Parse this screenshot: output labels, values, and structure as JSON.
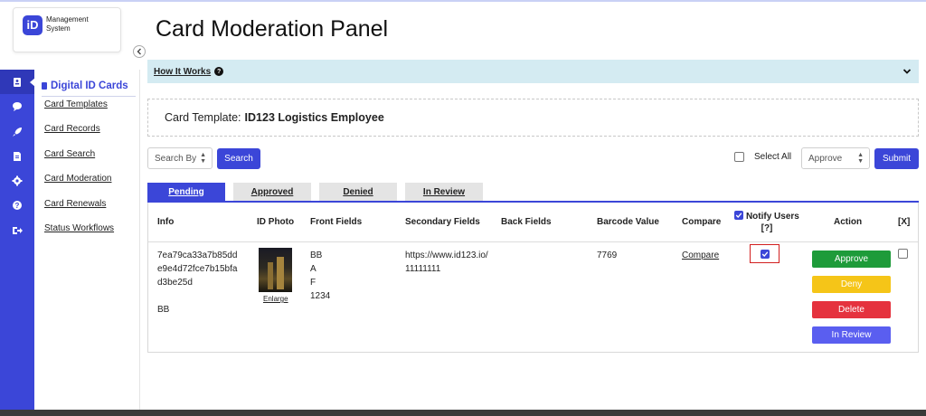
{
  "brand": {
    "logo_letters": "iD",
    "line1": "Management",
    "line2": "System"
  },
  "rail": {
    "icons": [
      "id-card-icon",
      "chat-icon",
      "rocket-icon",
      "document-icon",
      "gear-icon",
      "help-icon",
      "logout-icon"
    ]
  },
  "sidebar": {
    "heading": "Digital ID Cards",
    "items": [
      {
        "label": "Card Templates"
      },
      {
        "label": "Card Records"
      },
      {
        "label": "Card Search"
      },
      {
        "label": "Card Moderation"
      },
      {
        "label": "Card Renewals"
      },
      {
        "label": "Status Workflows"
      }
    ]
  },
  "page": {
    "title": "Card Moderation Panel"
  },
  "how_it_works": {
    "label": "How It Works"
  },
  "template": {
    "label": "Card Template:",
    "value": "ID123 Logistics Employee"
  },
  "toolbar": {
    "search_by": "Search By",
    "search_button": "Search",
    "select_all": "Select All",
    "action_select": "Approve",
    "submit_button": "Submit"
  },
  "tabs": [
    {
      "label": "Pending",
      "active": true
    },
    {
      "label": "Approved",
      "active": false
    },
    {
      "label": "Denied",
      "active": false
    },
    {
      "label": "In Review",
      "active": false
    }
  ],
  "table": {
    "headers": {
      "info": "Info",
      "id_photo": "ID Photo",
      "front_fields": "Front Fields",
      "secondary_fields": "Secondary Fields",
      "back_fields": "Back Fields",
      "barcode_value": "Barcode Value",
      "compare": "Compare",
      "notify_users": "Notify Users",
      "notify_help": "[?]",
      "action": "Action",
      "x": "[X]"
    },
    "rows": [
      {
        "info_line1": "7ea79ca33a7b85dd",
        "info_line2": "e9e4d72fce7b15bfa",
        "info_line3": "d3be25d",
        "info_name": "BB",
        "photo_link": "Enlarge",
        "front_1": "BB",
        "front_2": "A",
        "front_3": "F",
        "front_4": "1234",
        "secondary_1": "https://www.id123.io/",
        "secondary_2": "11111111",
        "barcode": "7769",
        "compare": "Compare",
        "notify_checked": true,
        "actions": {
          "approve": "Approve",
          "deny": "Deny",
          "delete": "Delete",
          "in_review": "In Review"
        }
      }
    ]
  },
  "colors": {
    "primary": "#3b46d8",
    "info_banner": "#d4ebf2",
    "approve": "#1e9b3a",
    "deny": "#f5c518",
    "delete": "#e5323e",
    "in_review": "#5a5ef0"
  }
}
